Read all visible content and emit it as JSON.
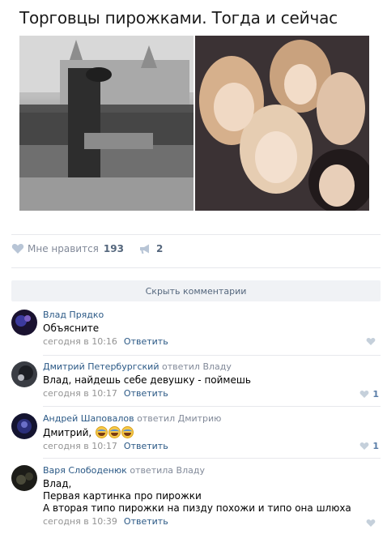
{
  "post": {
    "title": "Торговцы пирожками. Тогда и сейчас"
  },
  "actions": {
    "like_label": "Мне нравится",
    "like_count": "193",
    "share_count": "2"
  },
  "hide_comments_label": "Скрыть комментарии",
  "reply_label": "Ответить",
  "comments": [
    {
      "author": "Влад Прядко",
      "reply_to": "",
      "text_lines": [
        "Объясните"
      ],
      "time": "сегодня в 10:16",
      "likes": ""
    },
    {
      "author": "Дмитрий Петербургский",
      "reply_to": "ответил Владу",
      "text_lines": [
        "Влад, найдешь себе девушку - поймешь"
      ],
      "time": "сегодня в 10:17",
      "likes": "1"
    },
    {
      "author": "Андрей Шаповалов",
      "reply_to": "ответил Дмитрию",
      "text_lines": [
        "Дмитрий,"
      ],
      "time": "сегодня в 10:17",
      "likes": "1"
    },
    {
      "author": "Варя Слободенюк",
      "reply_to": "ответила Владу",
      "text_lines": [
        "Влад,",
        "Первая картинка про пирожки",
        "А вторая типо пирожки на пизду похожи и типо она шлюха"
      ],
      "time": "сегодня в 10:39",
      "likes": ""
    }
  ],
  "colors": {
    "link": "#2a5885",
    "muted": "#828a99",
    "divider": "#e7e8ec",
    "button_bg": "#f0f2f5"
  },
  "icons": [
    "heart-icon",
    "megaphone-icon",
    "laughing-emoji-icon"
  ]
}
